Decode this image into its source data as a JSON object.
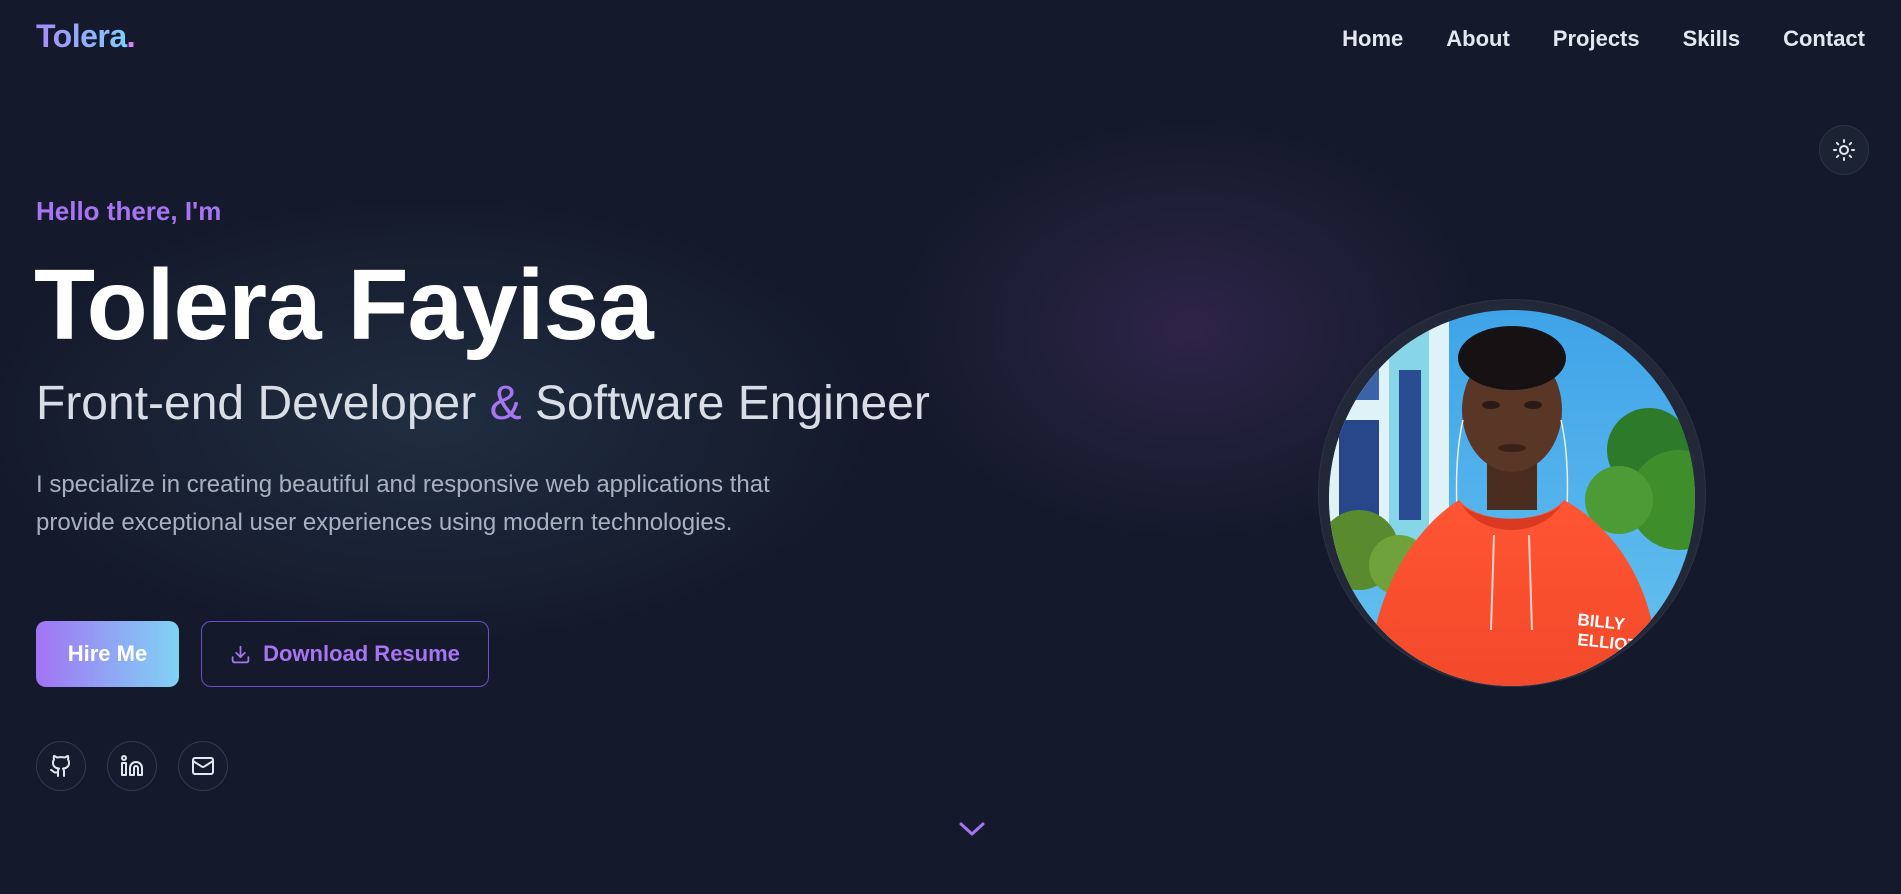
{
  "brand": {
    "logo_text": "Tolera",
    "logo_dot": "."
  },
  "nav": {
    "items": [
      {
        "label": "Home"
      },
      {
        "label": "About"
      },
      {
        "label": "Projects"
      },
      {
        "label": "Skills"
      },
      {
        "label": "Contact"
      }
    ]
  },
  "theme_toggle": {
    "icon": "sun-icon"
  },
  "hero": {
    "greeting": "Hello there, I'm",
    "name": "Tolera Fayisa",
    "role_part1": "Front-end Developer",
    "role_amp": "&",
    "role_part2": "Software Engineer",
    "description": "I specialize in creating beautiful and responsive web applications that provide exceptional user experiences using modern technologies.",
    "hire_label": "Hire Me",
    "resume_label": "Download Resume"
  },
  "socials": [
    {
      "icon": "github-icon"
    },
    {
      "icon": "linkedin-icon"
    },
    {
      "icon": "mail-icon"
    }
  ],
  "avatar": {
    "hoodie_text_line1": "BILLY",
    "hoodie_text_line2": "ELLIOT"
  },
  "colors": {
    "background": "#141a2b",
    "accent": "#a774f2",
    "gradient_start": "#a274f4",
    "gradient_end": "#7fd3f5"
  }
}
